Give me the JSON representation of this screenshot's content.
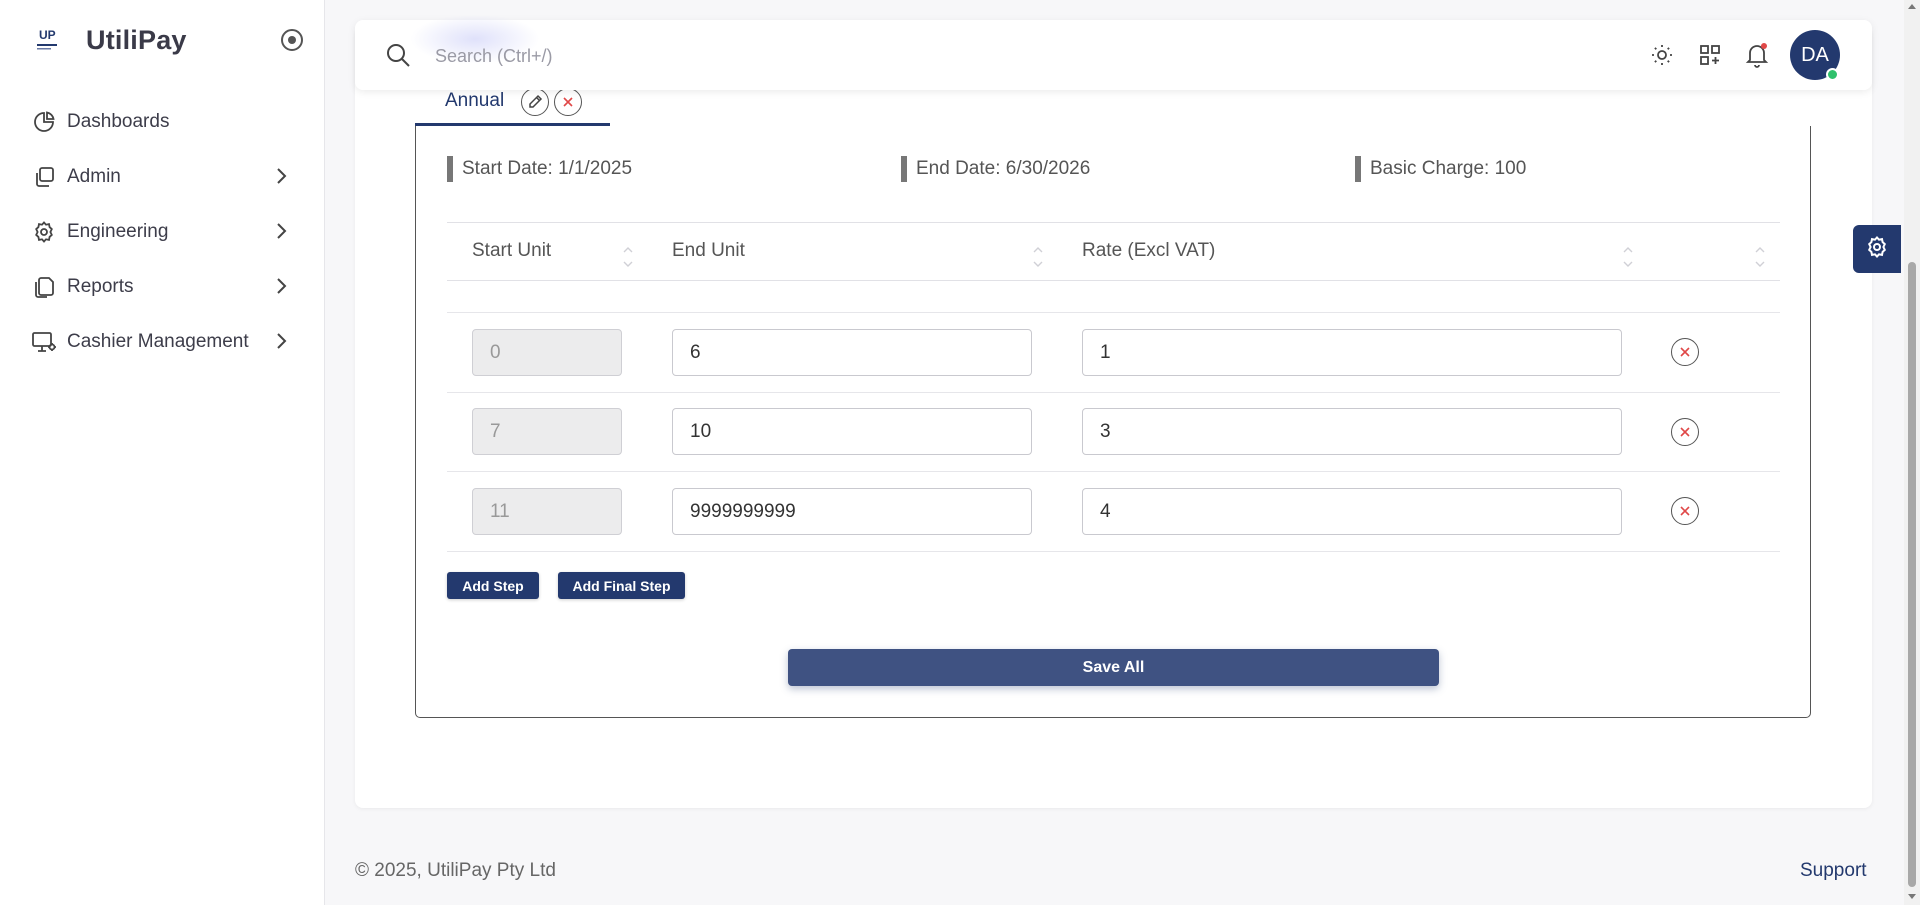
{
  "app": {
    "name": "UtiliPay",
    "logo_text": "UP"
  },
  "colors": {
    "primary": "#23396e",
    "save_button": "#3f5282",
    "danger": "#e04848",
    "online": "#2fc06b",
    "notification": "#e04848"
  },
  "sidebar": {
    "items": [
      {
        "label": "Dashboards",
        "icon": "pie-chart-icon",
        "has_children": false
      },
      {
        "label": "Admin",
        "icon": "copy-icon",
        "has_children": true
      },
      {
        "label": "Engineering",
        "icon": "gear-icon",
        "has_children": true
      },
      {
        "label": "Reports",
        "icon": "files-icon",
        "has_children": true
      },
      {
        "label": "Cashier Management",
        "icon": "monitor-gear-icon",
        "has_children": true
      }
    ]
  },
  "header": {
    "search_placeholder": "Search (Ctrl+/)",
    "icons": [
      "sun-icon",
      "apps-add-icon",
      "bell-icon"
    ],
    "avatar_initials": "DA"
  },
  "tariff": {
    "tab_label": "Annual",
    "start_date": "Start Date: 1/1/2025",
    "end_date": "End Date: 6/30/2026",
    "basic_charge": "Basic Charge: 100",
    "columns": [
      "Start Unit",
      "End Unit",
      "Rate (Excl VAT)"
    ],
    "rows": [
      {
        "start_unit": "0",
        "end_unit": "6",
        "rate": "1"
      },
      {
        "start_unit": "7",
        "end_unit": "10",
        "rate": "3"
      },
      {
        "start_unit": "11",
        "end_unit": "9999999999",
        "rate": "4"
      }
    ],
    "add_step_label": "Add Step",
    "add_final_step_label": "Add Final Step",
    "save_all_label": "Save All"
  },
  "footer": {
    "copyright": "© 2025, UtiliPay Pty Ltd",
    "support_label": "Support"
  }
}
